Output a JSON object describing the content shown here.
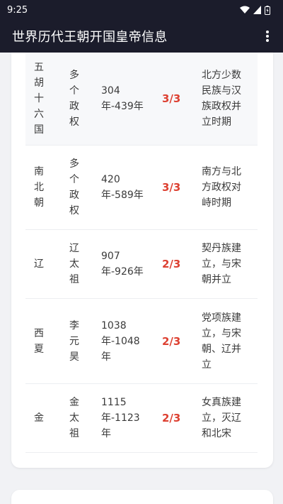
{
  "status_bar": {
    "time": "9:25"
  },
  "app_bar": {
    "title": "世界历代王朝开国皇帝信息"
  },
  "rows": [
    {
      "name": "五胡十六国",
      "founder": "多个政权",
      "period": "304 年-439年",
      "score": "3/3",
      "note": "北方少数民族与汉族政权并立时期"
    },
    {
      "name": "南北朝",
      "founder": "多个政权",
      "period": "420 年-589年",
      "score": "3/3",
      "note": "南方与北方政权对峙时期"
    },
    {
      "name": "辽",
      "founder": "辽太祖",
      "period": "907 年-926年",
      "score": "2/3",
      "note": "契丹族建立，与宋朝并立"
    },
    {
      "name": "西夏",
      "founder": "李元昊",
      "period": "1038 年-1048 年",
      "score": "2/3",
      "note": "党项族建立，与宋朝、辽并立"
    },
    {
      "name": "金",
      "founder": "金太祖",
      "period": "1115 年-1123 年",
      "score": "2/3",
      "note": "女真族建立，灭辽和北宋"
    }
  ],
  "colors": {
    "app_bar": "#1b1c2b",
    "score": "#dd4132",
    "background": "#f1f2f5"
  },
  "icons": [
    "wifi-icon",
    "signal-icon",
    "battery-icon",
    "more-vert-icon"
  ]
}
